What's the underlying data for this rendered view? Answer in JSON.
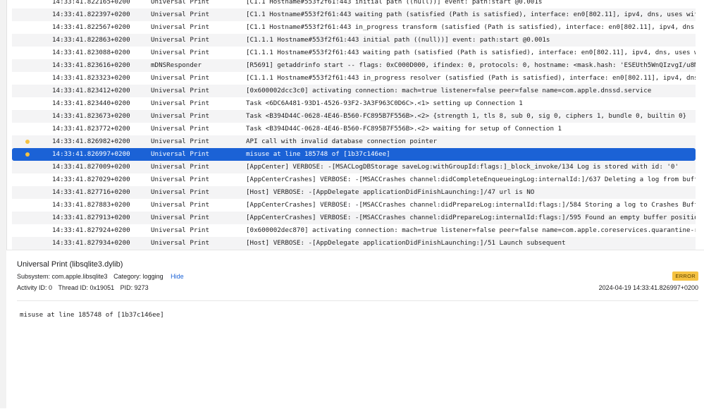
{
  "log_rows": [
    {
      "time": "14:33:41.822165+0200",
      "process": "Universal Print",
      "message": "[C1.1 Hostname#553f2f61:443 initial path ((null))] event: path:start @0.001s",
      "dot": false,
      "selected": false
    },
    {
      "time": "14:33:41.822397+0200",
      "process": "Universal Print",
      "message": "[C1.1 Hostname#553f2f61:443 waiting path (satisfied (Path is satisfied), interface: en0[802.11], ipv4, dns, uses wifi)] event",
      "dot": false,
      "selected": false
    },
    {
      "time": "14:33:41.822567+0200",
      "process": "Universal Print",
      "message": "[C1.1 Hostname#553f2f61:443 in_progress transform (satisfied (Path is satisfied), interface: en0[802.11], ipv4, dns, uses wi",
      "dot": false,
      "selected": false
    },
    {
      "time": "14:33:41.822863+0200",
      "process": "Universal Print",
      "message": "[C1.1.1 Hostname#553f2f61:443 initial path ((null))] event: path:start @0.001s",
      "dot": false,
      "selected": false
    },
    {
      "time": "14:33:41.823088+0200",
      "process": "Universal Print",
      "message": "[C1.1.1 Hostname#553f2f61:443 waiting path (satisfied (Path is satisfied), interface: en0[802.11], ipv4, dns, uses wifi)] eve",
      "dot": false,
      "selected": false
    },
    {
      "time": "14:33:41.823616+0200",
      "process": "mDNSResponder",
      "message": "[R5691] getaddrinfo start -- flags: 0xC000D000, ifindex: 0, protocols: 0, hostname: <mask.hash: 'ESEUth5WnQIzvgI/u8Ma3w=='>,",
      "dot": false,
      "selected": false
    },
    {
      "time": "14:33:41.823323+0200",
      "process": "Universal Print",
      "message": "[C1.1.1 Hostname#553f2f61:443 in_progress resolver (satisfied (Path is satisfied), interface: en0[802.11], ipv4, dns, uses wi",
      "dot": false,
      "selected": false
    },
    {
      "time": "14:33:41.823412+0200",
      "process": "Universal Print",
      "message": "[0x600002dcc3c0] activating connection: mach=true listener=false peer=false name=com.apple.dnssd.service",
      "dot": false,
      "selected": false
    },
    {
      "time": "14:33:41.823440+0200",
      "process": "Universal Print",
      "message": "Task <6DC6A481-93D1-4526-93F2-3A3F963C0D6C>.<1> setting up Connection 1",
      "dot": false,
      "selected": false
    },
    {
      "time": "14:33:41.823673+0200",
      "process": "Universal Print",
      "message": "Task <B394D44C-0628-4E46-B560-FC895B7F556B>.<2> {strength 1, tls 8, sub 0, sig 0, ciphers 1, bundle 0, builtin 0}",
      "dot": false,
      "selected": false
    },
    {
      "time": "14:33:41.823772+0200",
      "process": "Universal Print",
      "message": "Task <B394D44C-0628-4E46-B560-FC895B7F556B>.<2> waiting for setup of Connection 1",
      "dot": false,
      "selected": false
    },
    {
      "time": "14:33:41.826982+0200",
      "process": "Universal Print",
      "message": "API call with invalid database connection pointer",
      "dot": true,
      "selected": false
    },
    {
      "time": "14:33:41.826997+0200",
      "process": "Universal Print",
      "message": "misuse at line 185748 of [1b37c146ee]",
      "dot": true,
      "selected": true
    },
    {
      "time": "14:33:41.827009+0200",
      "process": "Universal Print",
      "message": "[AppCenter] VERBOSE: -[MSACLogDBStorage saveLog:withGroupId:flags:]_block_invoke/134 Log is stored with id: '0'",
      "dot": false,
      "selected": false
    },
    {
      "time": "14:33:41.827029+0200",
      "process": "Universal Print",
      "message": "[AppCenterCrashes] VERBOSE: -[MSACCrashes channel:didCompleteEnqueueingLog:internalId:]/637 Deleting a log from buffer with i",
      "dot": false,
      "selected": false
    },
    {
      "time": "14:33:41.827716+0200",
      "process": "Universal Print",
      "message": "[Host] VERBOSE: -[AppDelegate applicationDidFinishLaunching:]/47 url is NO",
      "dot": false,
      "selected": false
    },
    {
      "time": "14:33:41.827883+0200",
      "process": "Universal Print",
      "message": "[AppCenterCrashes] VERBOSE: -[MSACCrashes channel:didPrepareLog:internalId:flags:]/584 Storing a log to Crashes Buffer: (sid:",
      "dot": false,
      "selected": false
    },
    {
      "time": "14:33:41.827913+0200",
      "process": "Universal Print",
      "message": "[AppCenterCrashes] VERBOSE: -[MSACCrashes channel:didPrepareLog:internalId:flags:]/595 Found an empty buffer position.",
      "dot": false,
      "selected": false
    },
    {
      "time": "14:33:41.827924+0200",
      "process": "Universal Print",
      "message": "[0x600002dec870] activating connection: mach=true listener=false peer=false name=com.apple.coreservices.quarantine-resolver",
      "dot": false,
      "selected": false
    },
    {
      "time": "14:33:41.827934+0200",
      "process": "Universal Print",
      "message": "[Host] VERBOSE: -[AppDelegate applicationDidFinishLaunching:]/51 Launch subsequent",
      "dot": false,
      "selected": false
    }
  ],
  "detail": {
    "title": "Universal Print (libsqlite3.dylib)",
    "subsystem": "Subsystem: com.apple.libsqlite3",
    "category": "Category: logging",
    "hide_label": "Hide",
    "activity_id": "Activity ID: 0",
    "thread_id": "Thread ID: 0x19051",
    "pid": "PID: 9273",
    "level_badge": "ERROR",
    "timestamp": "2024-04-19 14:33:41.826997+0200",
    "message": "misuse at line 185748 of [1b37c146ee]"
  },
  "colors": {
    "selection": "#1b62d6",
    "fault_dot": "#f5c242",
    "badge": "#f5c242",
    "link": "#1b62d6"
  }
}
